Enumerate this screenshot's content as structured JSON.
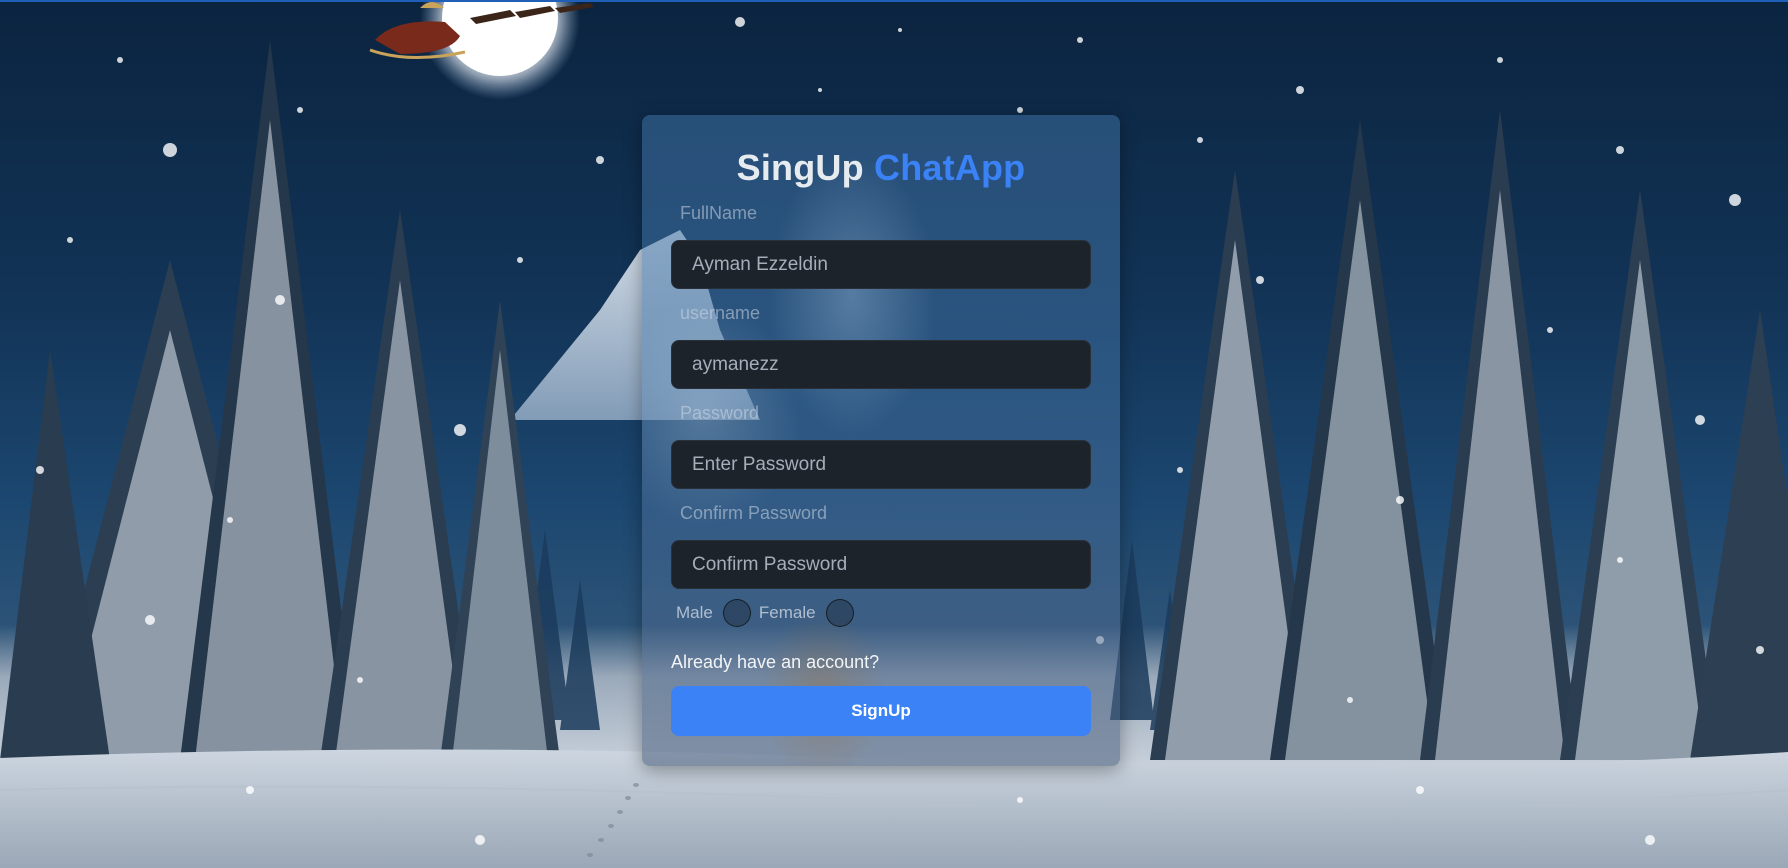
{
  "page": {
    "background": "snowy-night-forest-scene"
  },
  "colors": {
    "accent": "#3b82f6",
    "input_bg": "#1d232a",
    "button_text": "#ffffff"
  },
  "form": {
    "title_main": "SingUp",
    "title_accent": "ChatApp",
    "fullname": {
      "label": "FullName",
      "value": "Ayman Ezzeldin"
    },
    "username": {
      "label": "username",
      "value": "aymanezz"
    },
    "password": {
      "label": "Password",
      "placeholder": "Enter Password",
      "value": ""
    },
    "confirm_password": {
      "label": "Confirm Password",
      "placeholder": "Confirm Password",
      "value": ""
    },
    "gender": {
      "male_label": "Male",
      "female_label": "Female"
    },
    "login_link": "Already have an account?",
    "submit_label": "SignUp"
  }
}
